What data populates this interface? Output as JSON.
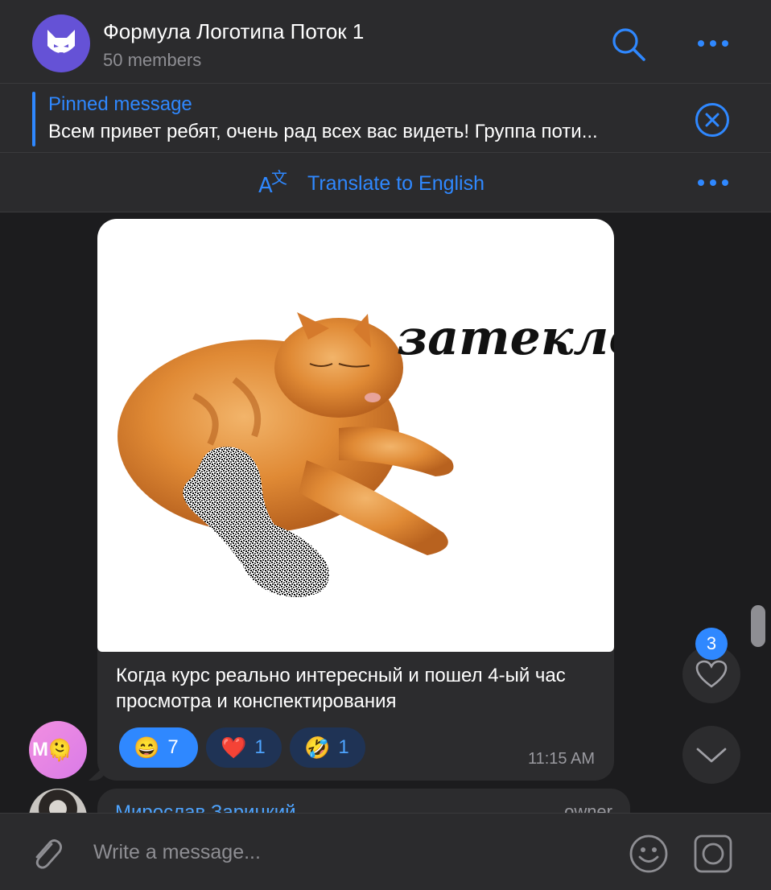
{
  "header": {
    "title": "Формула Логотипа Поток 1",
    "members": "50 members"
  },
  "pinned": {
    "label": "Pinned message",
    "text": "Всем привет ребят, очень рад всех вас видеть!  Группа поти..."
  },
  "translate": {
    "label": "Translate to English"
  },
  "message": {
    "photo_text": "затекло",
    "caption": "Когда курс реально интересный и пошел 4-ый час просмотра и конспектирования",
    "time": "11:15 AM",
    "avatar_initial": "M",
    "reactions": [
      {
        "emoji": "😄",
        "count": "7",
        "active": true
      },
      {
        "emoji": "❤️",
        "count": "1",
        "active": false
      },
      {
        "emoji": "🤣",
        "count": "1",
        "active": false
      }
    ]
  },
  "next_message": {
    "author": "Мирослав Зарицкий",
    "role": "owner"
  },
  "fab": {
    "reactions_badge": "3"
  },
  "composer": {
    "placeholder": "Write a message..."
  },
  "colors": {
    "accent": "#2f88ff",
    "background": "#1c1c1e",
    "panel": "#2b2b2d",
    "bubble": "#2c2c2e"
  }
}
